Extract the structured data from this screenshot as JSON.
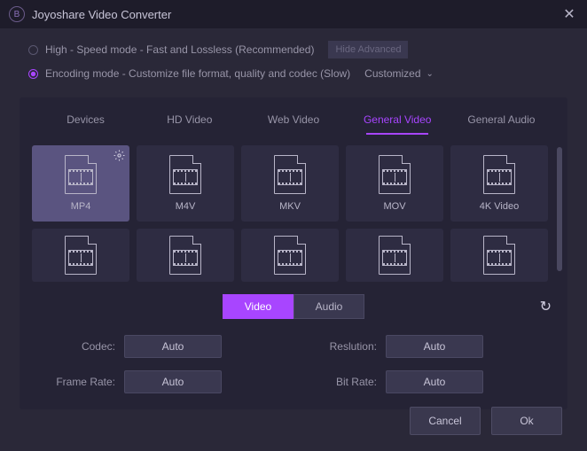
{
  "window": {
    "title": "Joyoshare Video Converter"
  },
  "modes": {
    "high_speed": {
      "label": "High - Speed mode - Fast and Lossless (Recommended)",
      "selected": false
    },
    "encoding": {
      "label": "Encoding mode - Customize file format, quality and codec (Slow)",
      "selected": true
    },
    "hide_advanced": "Hide Advanced",
    "customized": "Customized"
  },
  "tabs": [
    "Devices",
    "HD Video",
    "Web Video",
    "General Video",
    "General Audio"
  ],
  "active_tab": "General Video",
  "formats_row1": [
    {
      "label": "MP4",
      "selected": true,
      "gear": true
    },
    {
      "label": "M4V"
    },
    {
      "label": "MKV"
    },
    {
      "label": "MOV"
    },
    {
      "label": "4K Video"
    }
  ],
  "formats_row2_count": 5,
  "va_tabs": {
    "video": "Video",
    "audio": "Audio",
    "active": "Video"
  },
  "params": {
    "codec": {
      "label": "Codec:",
      "value": "Auto"
    },
    "resolution": {
      "label": "Reslution:",
      "value": "Auto"
    },
    "frame_rate": {
      "label": "Frame Rate:",
      "value": "Auto"
    },
    "bit_rate": {
      "label": "Bit Rate:",
      "value": "Auto"
    }
  },
  "footer": {
    "cancel": "Cancel",
    "ok": "Ok"
  }
}
